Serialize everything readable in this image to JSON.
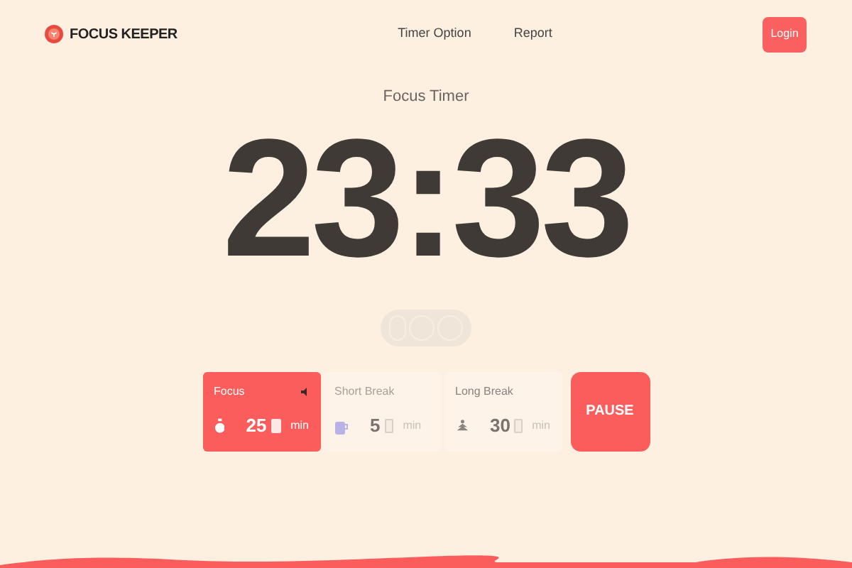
{
  "brand": "FOCUS KEEPER",
  "nav": [
    "Timer Option",
    "Report"
  ],
  "login": "Login",
  "heading": "Focus Timer",
  "time": "23:33",
  "modes": [
    {
      "label": "Focus",
      "minutes": "25",
      "unit": "min",
      "selected": true,
      "kind": "focus"
    },
    {
      "label": "Short Break",
      "minutes": "5",
      "unit": "min",
      "selected": false,
      "kind": "short"
    },
    {
      "label": "Long Break",
      "minutes": "30",
      "unit": "min",
      "selected": false,
      "kind": "long"
    }
  ],
  "action": "PAUSE"
}
